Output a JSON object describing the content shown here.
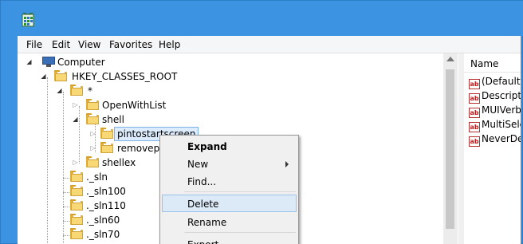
{
  "menubar": {
    "items": [
      "File",
      "Edit",
      "View",
      "Favorites",
      "Help"
    ]
  },
  "tree": {
    "computer": "Computer",
    "root": "HKEY_CLASSES_ROOT",
    "star": "*",
    "openwithlist": "OpenWithList",
    "shell": "shell",
    "pintostartscreen": "pintostartscreen",
    "removeprefix": "removepre",
    "shellex": "shellex",
    "items": [
      "._sln",
      "._sln100",
      "._sln110",
      "._sln60",
      "._sln70"
    ]
  },
  "values": {
    "header": "Name",
    "rows": [
      "(Default)",
      "Description",
      "MUIVerb",
      "MultiSelect",
      "NeverDefault"
    ]
  },
  "context_menu": {
    "expand": "Expand",
    "new": "New",
    "find": "Find...",
    "delete": "Delete",
    "rename": "Rename",
    "export": "Export"
  },
  "colors": {
    "titlebar": "#3b93e2",
    "selection": "#dcecfc",
    "menu_hover": "#dce9f7"
  }
}
